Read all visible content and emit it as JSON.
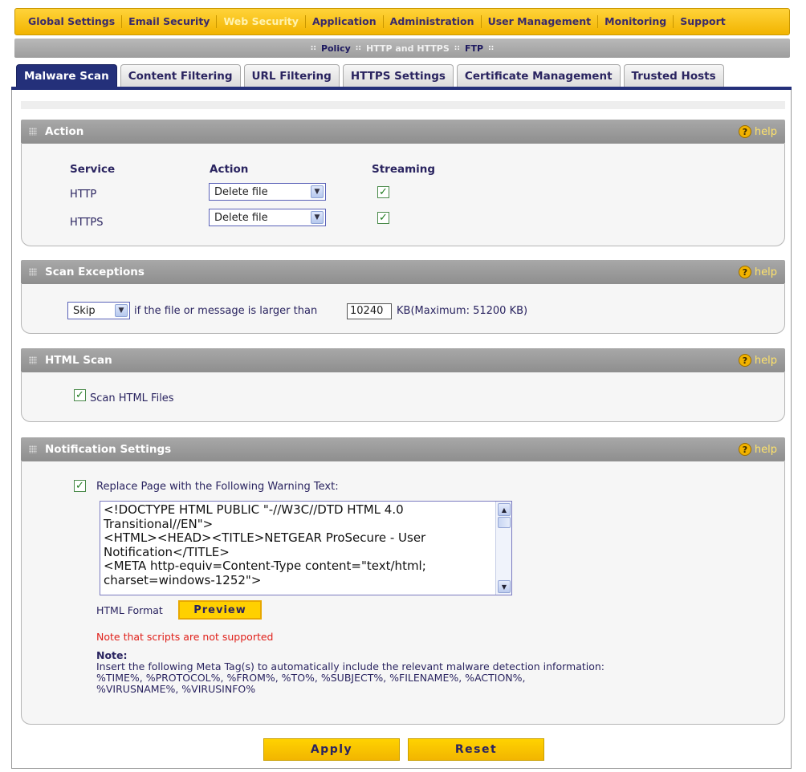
{
  "topnav": {
    "items": [
      "Global Settings",
      "Email Security",
      "Web Security",
      "Application",
      "Administration",
      "User Management",
      "Monitoring",
      "Support"
    ],
    "active_index": 2
  },
  "subnav": {
    "items": [
      "Policy",
      "HTTP and HTTPS",
      "FTP"
    ]
  },
  "tabs": {
    "items": [
      "Malware Scan",
      "Content Filtering",
      "URL Filtering",
      "HTTPS Settings",
      "Certificate Management",
      "Trusted Hosts"
    ],
    "active_index": 0
  },
  "help_label": "help",
  "action": {
    "title": "Action",
    "col_service": "Service",
    "col_action": "Action",
    "col_streaming": "Streaming",
    "rows": [
      {
        "service": "HTTP",
        "action": "Delete file",
        "streaming": true
      },
      {
        "service": "HTTPS",
        "action": "Delete file",
        "streaming": true
      }
    ]
  },
  "scan_exceptions": {
    "title": "Scan Exceptions",
    "mode": "Skip",
    "text_before": "if the file or message is larger than",
    "size_value": "10240",
    "text_after": "KB(Maximum: 51200 KB)"
  },
  "html_scan": {
    "title": "HTML Scan",
    "checkbox_label": "Scan HTML Files",
    "checked": true
  },
  "notification": {
    "title": "Notification Settings",
    "replace_label": "Replace Page with the Following Warning Text:",
    "replace_checked": true,
    "warning_text": "<!DOCTYPE HTML PUBLIC \"-//W3C//DTD HTML 4.0 Transitional//EN\">\n<HTML><HEAD><TITLE>NETGEAR ProSecure - User Notification</TITLE>\n<META http-equiv=Content-Type content=\"text/html; charset=windows-1252\">",
    "format_label": "HTML Format",
    "preview_label": "Preview",
    "scripts_note": "Note that scripts are not supported",
    "note_title": "Note:",
    "note_line1": "Insert the following Meta Tag(s) to automatically include the relevant malware detection information:",
    "note_line2": "%TIME%, %PROTOCOL%, %FROM%, %TO%, %SUBJECT%, %FILENAME%, %ACTION%,",
    "note_line3": "%VIRUSNAME%, %VIRUSINFO%"
  },
  "buttons": {
    "apply": "Apply",
    "reset": "Reset"
  },
  "colors": {
    "accent_yellow": "#f2b400",
    "tab_active": "#24307a",
    "section_header": "#9a9a9a",
    "note_red": "#e0201a"
  }
}
